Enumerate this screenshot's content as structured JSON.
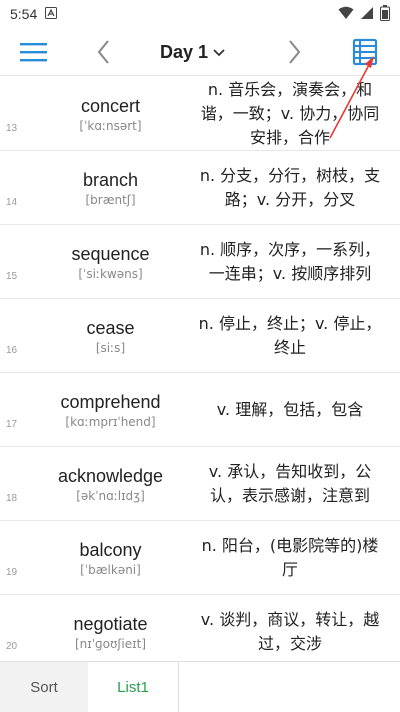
{
  "status_bar": {
    "time": "5:54"
  },
  "toolbar": {
    "day_label": "Day 1"
  },
  "words": [
    {
      "index": "13",
      "word": "concert",
      "phonetic": "[ˈkɑːnsərt]",
      "definition": "n. 音乐会，演奏会，和谐，一致；v. 协力，协同安排，合作"
    },
    {
      "index": "14",
      "word": "branch",
      "phonetic": "[bræntʃ]",
      "definition": "n. 分支，分行，树枝，支路；v. 分开，分叉"
    },
    {
      "index": "15",
      "word": "sequence",
      "phonetic": "[ˈsiːkwəns]",
      "definition": "n. 顺序，次序，一系列，一连串；v. 按顺序排列"
    },
    {
      "index": "16",
      "word": "cease",
      "phonetic": "[siːs]",
      "definition": "n. 停止，终止；v. 停止，终止"
    },
    {
      "index": "17",
      "word": "comprehend",
      "phonetic": "[kɑːmprɪˈhend]",
      "definition": "v. 理解，包括，包含"
    },
    {
      "index": "18",
      "word": "acknowledge",
      "phonetic": "[əkˈnɑːlɪdʒ]",
      "definition": "v. 承认，告知收到，公认，表示感谢，注意到"
    },
    {
      "index": "19",
      "word": "balcony",
      "phonetic": "[ˈbælkəni]",
      "definition": "n. 阳台，(电影院等的)楼厅"
    },
    {
      "index": "20",
      "word": "negotiate",
      "phonetic": "[nɪˈɡoʊʃieɪt]",
      "definition": "v. 谈判，商议，转让，越过，交涉"
    }
  ],
  "tabs": {
    "sort": "Sort",
    "list": "List1"
  },
  "colors": {
    "accent_blue": "#2a8bd8",
    "accent_green": "#2a9d4a",
    "annotation_red": "#e53935"
  },
  "icons": {
    "menu": "hamburger-menu-icon",
    "prev": "chevron-left-icon",
    "next": "chevron-right-icon",
    "dropdown": "chevron-down-icon",
    "list": "list-view-icon"
  }
}
